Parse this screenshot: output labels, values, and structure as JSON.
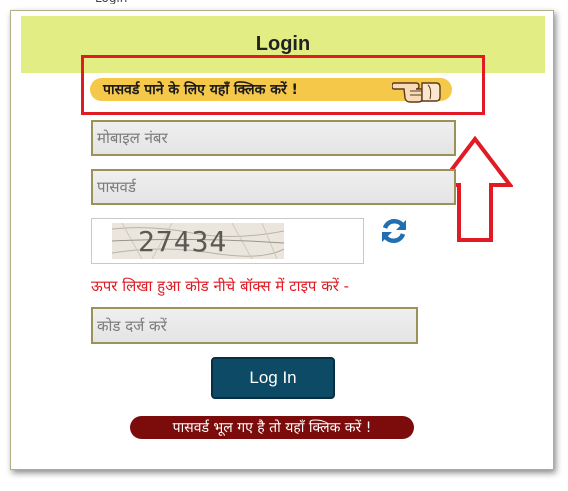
{
  "header": {
    "title": "Login"
  },
  "forgot_top": {
    "label": "पासवर्ड पाने के लिए यहाँ क्लिक करें !",
    "icon": "pointing-hand-icon"
  },
  "annotation": {
    "arrow_icon": "up-arrow-icon",
    "color": "#e01b24"
  },
  "form": {
    "mobile_placeholder": "मोबाइल नंबर",
    "password_placeholder": "पासवर्ड",
    "captcha_text": "27434",
    "refresh_icon": "refresh-icon",
    "hint": "ऊपर लिखा हुआ कोड नीचे बॉक्स में टाइप करें -",
    "code_placeholder": "कोड दर्ज करें",
    "login_label": "Log In"
  },
  "forgot_bottom": {
    "label": "पासवर्ड भूल गए है तो यहाँ क्लिक करें !"
  },
  "colors": {
    "header_bg": "#e2ee84",
    "pill_yellow": "#f6c84a",
    "button_blue": "#0c4a66",
    "pill_maroon": "#7c0b0b",
    "hint_red": "#e01b24"
  }
}
